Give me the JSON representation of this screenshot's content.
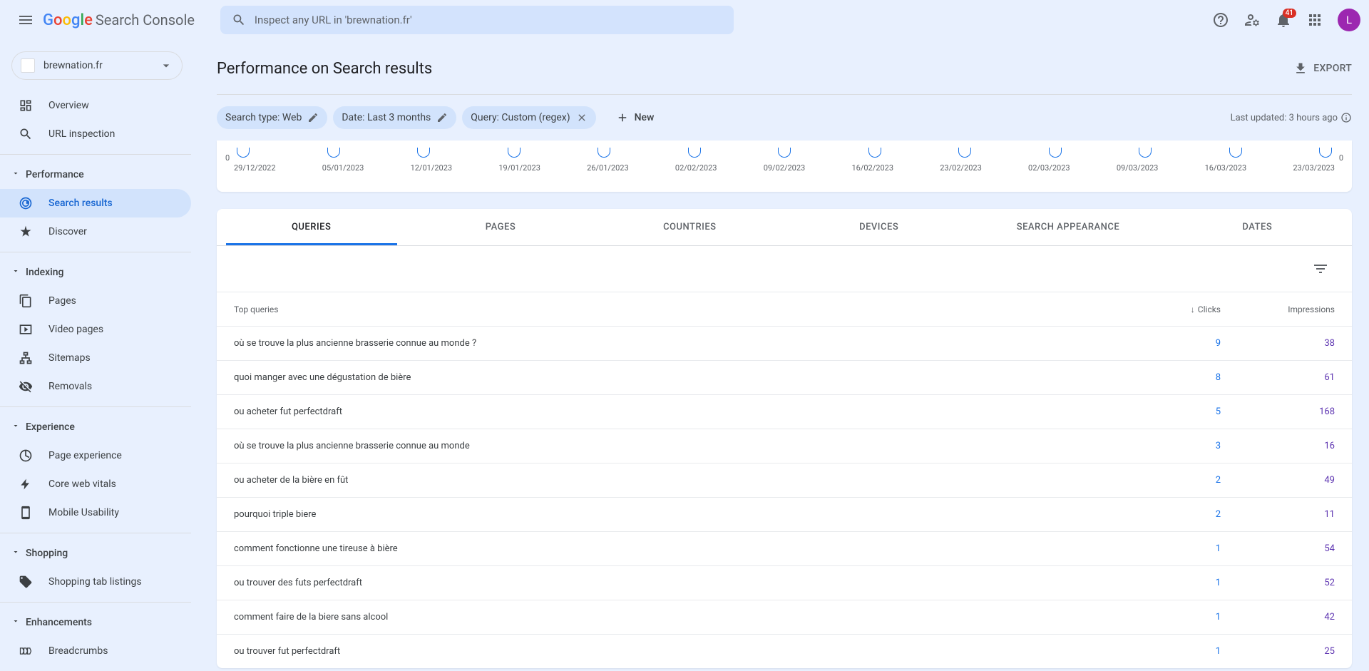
{
  "header": {
    "logo_suffix": "Search Console",
    "search_placeholder": "Inspect any URL in 'brewnation.fr'",
    "notification_count": "41",
    "avatar_initial": "L"
  },
  "sidebar": {
    "property": "brewnation.fr",
    "overview": "Overview",
    "url_inspection": "URL inspection",
    "sections": {
      "performance": "Performance",
      "indexing": "Indexing",
      "experience": "Experience",
      "shopping": "Shopping",
      "enhancements": "Enhancements"
    },
    "items": {
      "search_results": "Search results",
      "discover": "Discover",
      "pages": "Pages",
      "video_pages": "Video pages",
      "sitemaps": "Sitemaps",
      "removals": "Removals",
      "page_experience": "Page experience",
      "core_web_vitals": "Core web vitals",
      "mobile_usability": "Mobile Usability",
      "shopping_tab": "Shopping tab listings",
      "breadcrumbs": "Breadcrumbs"
    }
  },
  "page": {
    "title": "Performance on Search results",
    "export": "EXPORT",
    "filters": {
      "search_type": "Search type: Web",
      "date": "Date: Last 3 months",
      "query": "Query: Custom (regex)",
      "new": "New"
    },
    "last_updated": "Last updated: 3 hours ago"
  },
  "chart_data": {
    "type": "line",
    "axis_left_zero": "0",
    "axis_right_zero": "0",
    "dates": [
      "29/12/2022",
      "05/01/2023",
      "12/01/2023",
      "19/01/2023",
      "26/01/2023",
      "02/02/2023",
      "09/02/2023",
      "16/02/2023",
      "23/02/2023",
      "02/03/2023",
      "09/03/2023",
      "16/03/2023",
      "23/03/2023"
    ]
  },
  "tabs": {
    "queries": "QUERIES",
    "pages": "PAGES",
    "countries": "COUNTRIES",
    "devices": "DEVICES",
    "search_appearance": "SEARCH APPEARANCE",
    "dates": "DATES"
  },
  "table": {
    "head_queries": "Top queries",
    "head_clicks": "Clicks",
    "head_impressions": "Impressions",
    "rows": [
      {
        "q": "où se trouve la plus ancienne brasserie connue au monde ?",
        "c": "9",
        "i": "38"
      },
      {
        "q": "quoi manger avec une dégustation de bière",
        "c": "8",
        "i": "61"
      },
      {
        "q": "ou acheter fut perfectdraft",
        "c": "5",
        "i": "168"
      },
      {
        "q": "où se trouve la plus ancienne brasserie connue au monde",
        "c": "3",
        "i": "16"
      },
      {
        "q": "ou acheter de la bière en fût",
        "c": "2",
        "i": "49"
      },
      {
        "q": "pourquoi triple biere",
        "c": "2",
        "i": "11"
      },
      {
        "q": "comment fonctionne une tireuse à bière",
        "c": "1",
        "i": "54"
      },
      {
        "q": "ou trouver des futs perfectdraft",
        "c": "1",
        "i": "52"
      },
      {
        "q": "comment faire de la biere sans alcool",
        "c": "1",
        "i": "42"
      },
      {
        "q": "ou trouver fut perfectdraft",
        "c": "1",
        "i": "25"
      }
    ]
  }
}
